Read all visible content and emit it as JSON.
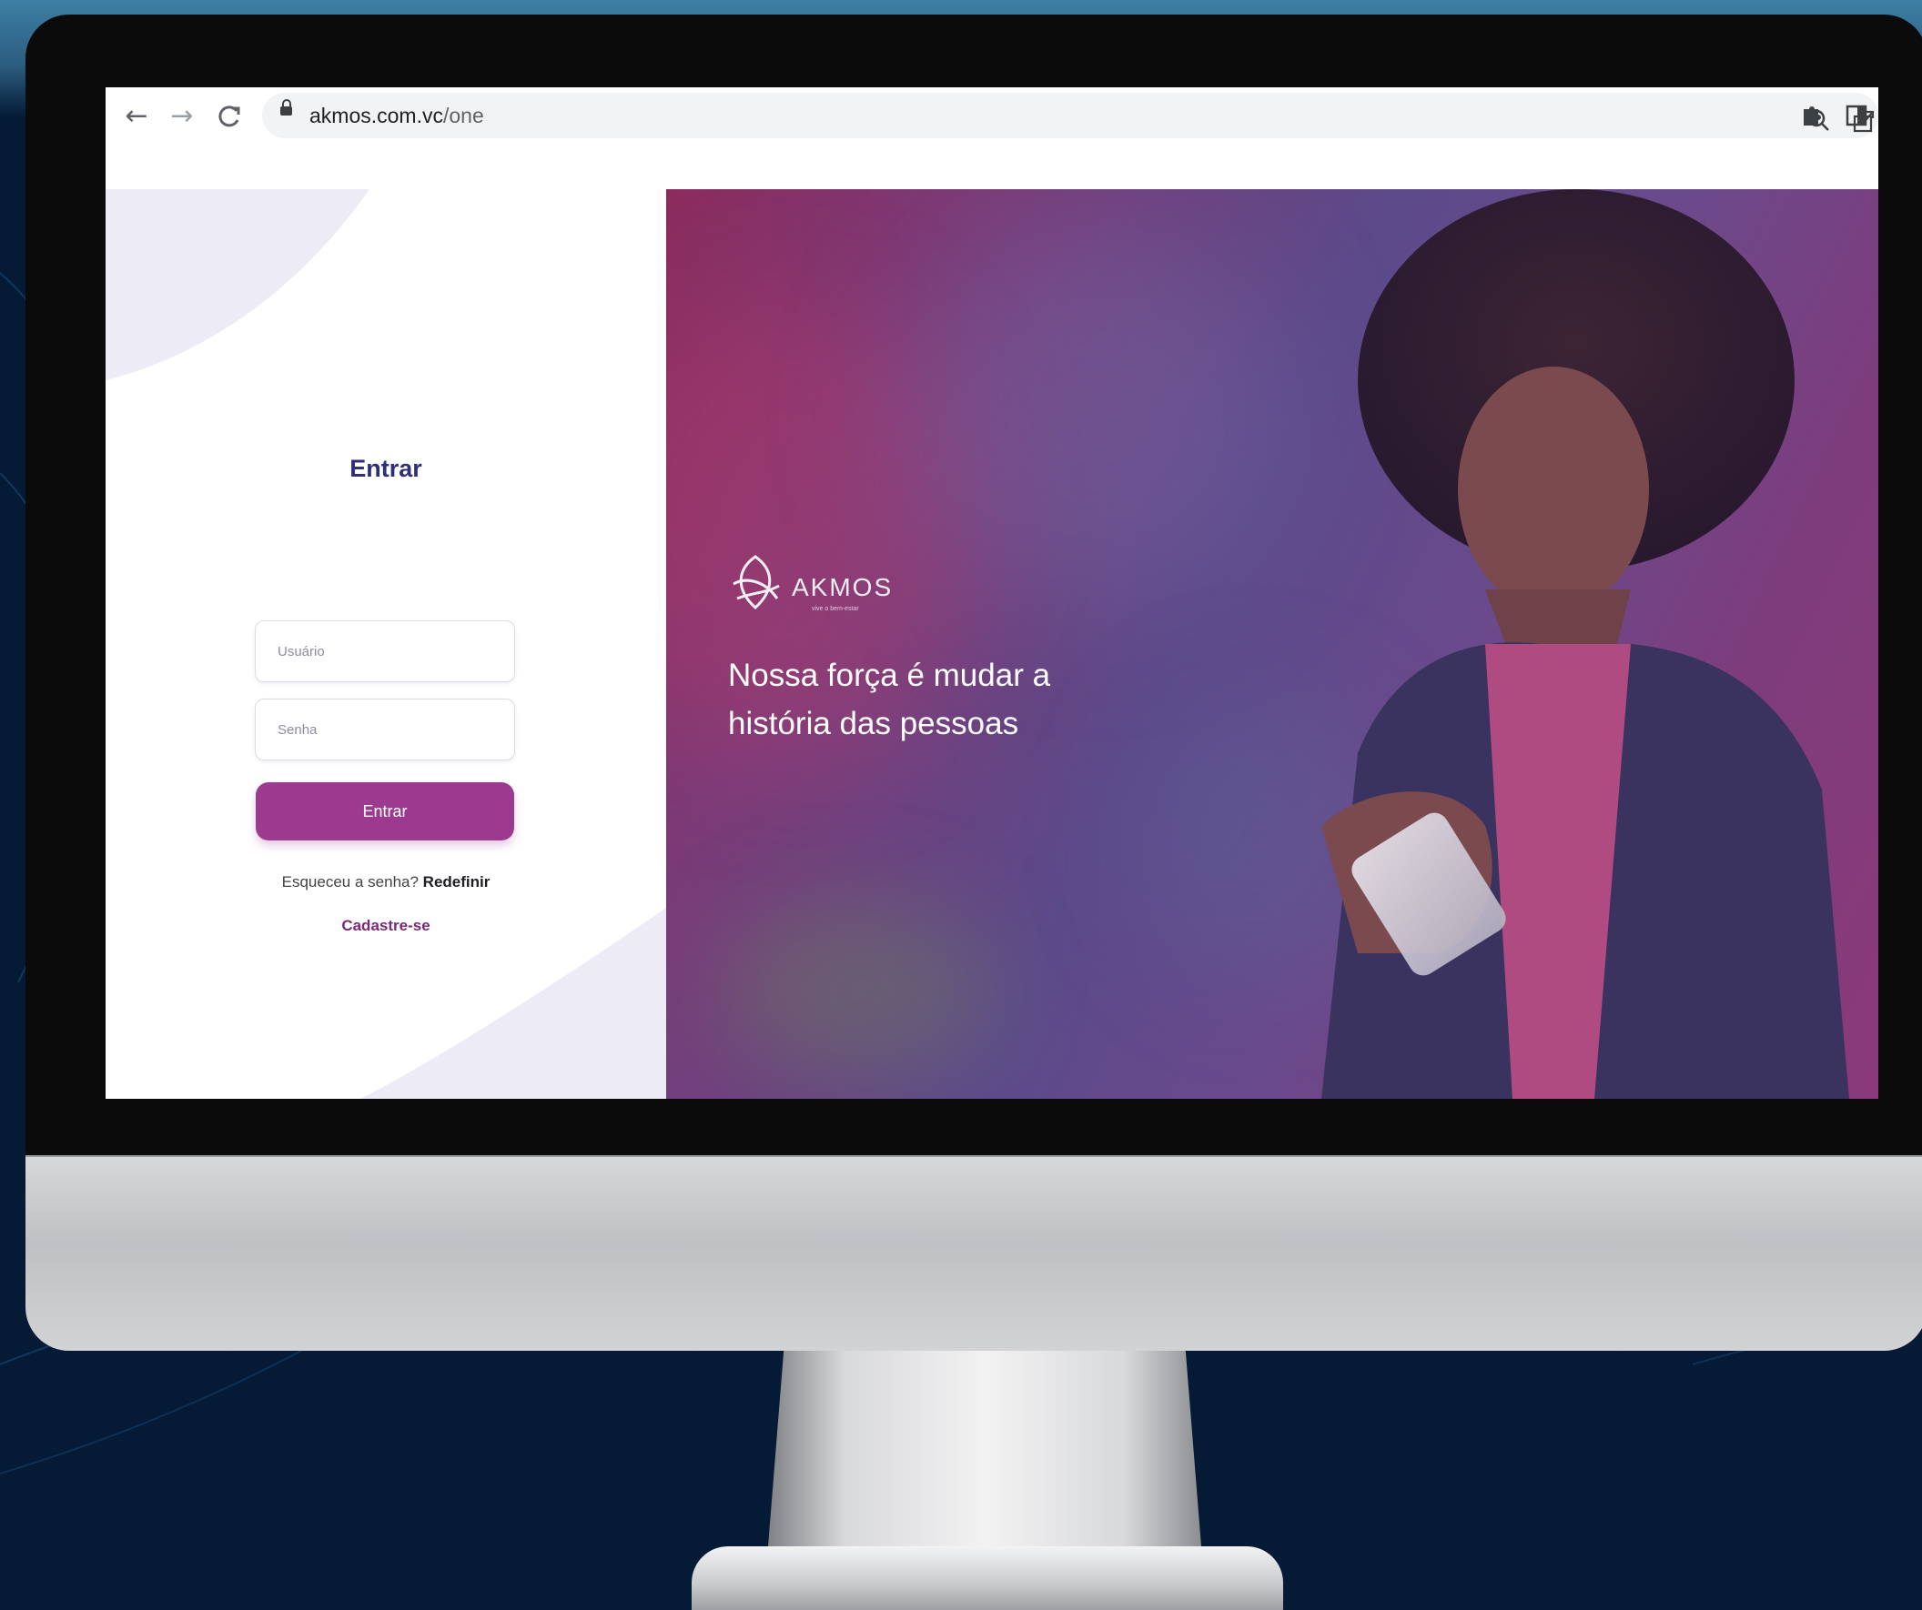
{
  "browser": {
    "url_host": "akmos.com.vc",
    "url_path": "/one",
    "icons": [
      "back-arrow-icon",
      "forward-arrow-icon",
      "reload-icon",
      "lock-icon",
      "zoom-icon",
      "share-icon",
      "star-icon",
      "extensions-icon",
      "side-panel-icon"
    ]
  },
  "login": {
    "title": "Entrar",
    "username_placeholder": "Usuário",
    "password_placeholder": "Senha",
    "submit_label": "Entrar",
    "forgot_text": "Esqueceu a senha?",
    "forgot_link": "Redefinir",
    "signup_label": "Cadastre-se"
  },
  "hero": {
    "brand": "AKMOS",
    "brand_sub": "vive o bem-estar",
    "tagline_line1": "Nossa força é mudar a",
    "tagline_line2": "história das pessoas"
  },
  "colors": {
    "accent": "#9b3a8f",
    "title": "#2e2f7a",
    "hero_overlay": "#6a4a8c",
    "background": "#041a35"
  }
}
